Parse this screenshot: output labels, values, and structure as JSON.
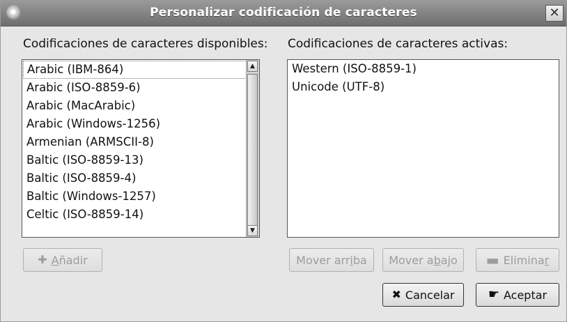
{
  "window": {
    "title": "Personalizar codificación de caracteres"
  },
  "available": {
    "label": "Codificaciones de caracteres disponibles:",
    "items": [
      "Arabic (IBM-864)",
      "Arabic (ISO-8859-6)",
      "Arabic (MacArabic)",
      "Arabic (Windows-1256)",
      "Armenian (ARMSCII-8)",
      "Baltic (ISO-8859-13)",
      "Baltic (ISO-8859-4)",
      "Baltic (Windows-1257)",
      "Celtic (ISO-8859-14)"
    ],
    "selected_index": 0
  },
  "active": {
    "label": "Codificaciones de caracteres activas:",
    "items": [
      "Western (ISO-8859-1)",
      "Unicode (UTF-8)"
    ]
  },
  "buttons": {
    "add": {
      "pre": "",
      "mnemonic": "A",
      "post": "ñadir",
      "icon": "plus-icon"
    },
    "move_up": {
      "pre": "Mover arr",
      "mnemonic": "i",
      "post": "ba"
    },
    "move_down": {
      "pre": "Mover a",
      "mnemonic": "b",
      "post": "ajo"
    },
    "remove": {
      "pre": "Elimina",
      "mnemonic": "r",
      "post": "",
      "icon": "minus-icon"
    },
    "cancel": {
      "label": "Cancelar",
      "icon": "cancel-x-icon"
    },
    "accept": {
      "label": "Aceptar",
      "icon": "accept-hand-icon"
    }
  }
}
